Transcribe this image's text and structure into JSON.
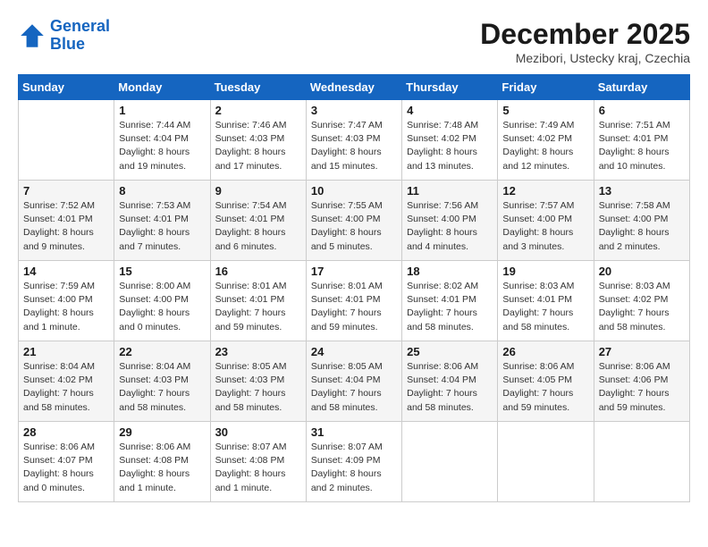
{
  "header": {
    "logo_line1": "General",
    "logo_line2": "Blue",
    "month": "December 2025",
    "location": "Mezibori, Ustecky kraj, Czechia"
  },
  "weekdays": [
    "Sunday",
    "Monday",
    "Tuesday",
    "Wednesday",
    "Thursday",
    "Friday",
    "Saturday"
  ],
  "weeks": [
    [
      {
        "day": "",
        "info": ""
      },
      {
        "day": "1",
        "info": "Sunrise: 7:44 AM\nSunset: 4:04 PM\nDaylight: 8 hours\nand 19 minutes."
      },
      {
        "day": "2",
        "info": "Sunrise: 7:46 AM\nSunset: 4:03 PM\nDaylight: 8 hours\nand 17 minutes."
      },
      {
        "day": "3",
        "info": "Sunrise: 7:47 AM\nSunset: 4:03 PM\nDaylight: 8 hours\nand 15 minutes."
      },
      {
        "day": "4",
        "info": "Sunrise: 7:48 AM\nSunset: 4:02 PM\nDaylight: 8 hours\nand 13 minutes."
      },
      {
        "day": "5",
        "info": "Sunrise: 7:49 AM\nSunset: 4:02 PM\nDaylight: 8 hours\nand 12 minutes."
      },
      {
        "day": "6",
        "info": "Sunrise: 7:51 AM\nSunset: 4:01 PM\nDaylight: 8 hours\nand 10 minutes."
      }
    ],
    [
      {
        "day": "7",
        "info": "Sunrise: 7:52 AM\nSunset: 4:01 PM\nDaylight: 8 hours\nand 9 minutes."
      },
      {
        "day": "8",
        "info": "Sunrise: 7:53 AM\nSunset: 4:01 PM\nDaylight: 8 hours\nand 7 minutes."
      },
      {
        "day": "9",
        "info": "Sunrise: 7:54 AM\nSunset: 4:01 PM\nDaylight: 8 hours\nand 6 minutes."
      },
      {
        "day": "10",
        "info": "Sunrise: 7:55 AM\nSunset: 4:00 PM\nDaylight: 8 hours\nand 5 minutes."
      },
      {
        "day": "11",
        "info": "Sunrise: 7:56 AM\nSunset: 4:00 PM\nDaylight: 8 hours\nand 4 minutes."
      },
      {
        "day": "12",
        "info": "Sunrise: 7:57 AM\nSunset: 4:00 PM\nDaylight: 8 hours\nand 3 minutes."
      },
      {
        "day": "13",
        "info": "Sunrise: 7:58 AM\nSunset: 4:00 PM\nDaylight: 8 hours\nand 2 minutes."
      }
    ],
    [
      {
        "day": "14",
        "info": "Sunrise: 7:59 AM\nSunset: 4:00 PM\nDaylight: 8 hours\nand 1 minute."
      },
      {
        "day": "15",
        "info": "Sunrise: 8:00 AM\nSunset: 4:00 PM\nDaylight: 8 hours\nand 0 minutes."
      },
      {
        "day": "16",
        "info": "Sunrise: 8:01 AM\nSunset: 4:01 PM\nDaylight: 7 hours\nand 59 minutes."
      },
      {
        "day": "17",
        "info": "Sunrise: 8:01 AM\nSunset: 4:01 PM\nDaylight: 7 hours\nand 59 minutes."
      },
      {
        "day": "18",
        "info": "Sunrise: 8:02 AM\nSunset: 4:01 PM\nDaylight: 7 hours\nand 58 minutes."
      },
      {
        "day": "19",
        "info": "Sunrise: 8:03 AM\nSunset: 4:01 PM\nDaylight: 7 hours\nand 58 minutes."
      },
      {
        "day": "20",
        "info": "Sunrise: 8:03 AM\nSunset: 4:02 PM\nDaylight: 7 hours\nand 58 minutes."
      }
    ],
    [
      {
        "day": "21",
        "info": "Sunrise: 8:04 AM\nSunset: 4:02 PM\nDaylight: 7 hours\nand 58 minutes."
      },
      {
        "day": "22",
        "info": "Sunrise: 8:04 AM\nSunset: 4:03 PM\nDaylight: 7 hours\nand 58 minutes."
      },
      {
        "day": "23",
        "info": "Sunrise: 8:05 AM\nSunset: 4:03 PM\nDaylight: 7 hours\nand 58 minutes."
      },
      {
        "day": "24",
        "info": "Sunrise: 8:05 AM\nSunset: 4:04 PM\nDaylight: 7 hours\nand 58 minutes."
      },
      {
        "day": "25",
        "info": "Sunrise: 8:06 AM\nSunset: 4:04 PM\nDaylight: 7 hours\nand 58 minutes."
      },
      {
        "day": "26",
        "info": "Sunrise: 8:06 AM\nSunset: 4:05 PM\nDaylight: 7 hours\nand 59 minutes."
      },
      {
        "day": "27",
        "info": "Sunrise: 8:06 AM\nSunset: 4:06 PM\nDaylight: 7 hours\nand 59 minutes."
      }
    ],
    [
      {
        "day": "28",
        "info": "Sunrise: 8:06 AM\nSunset: 4:07 PM\nDaylight: 8 hours\nand 0 minutes."
      },
      {
        "day": "29",
        "info": "Sunrise: 8:06 AM\nSunset: 4:08 PM\nDaylight: 8 hours\nand 1 minute."
      },
      {
        "day": "30",
        "info": "Sunrise: 8:07 AM\nSunset: 4:08 PM\nDaylight: 8 hours\nand 1 minute."
      },
      {
        "day": "31",
        "info": "Sunrise: 8:07 AM\nSunset: 4:09 PM\nDaylight: 8 hours\nand 2 minutes."
      },
      {
        "day": "",
        "info": ""
      },
      {
        "day": "",
        "info": ""
      },
      {
        "day": "",
        "info": ""
      }
    ]
  ]
}
